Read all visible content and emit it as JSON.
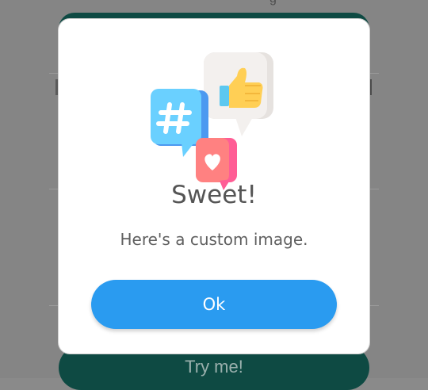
{
  "background": {
    "top_text": "g",
    "try_button_label": "Try me!"
  },
  "dialog": {
    "image_icon": "social-media-icons",
    "title": "Sweet!",
    "message": "Here's a custom image.",
    "ok_label": "Ok"
  },
  "colors": {
    "confirm_button": "#2a9bf0",
    "background_button": "#0e4a43",
    "overlay": "#858585"
  }
}
